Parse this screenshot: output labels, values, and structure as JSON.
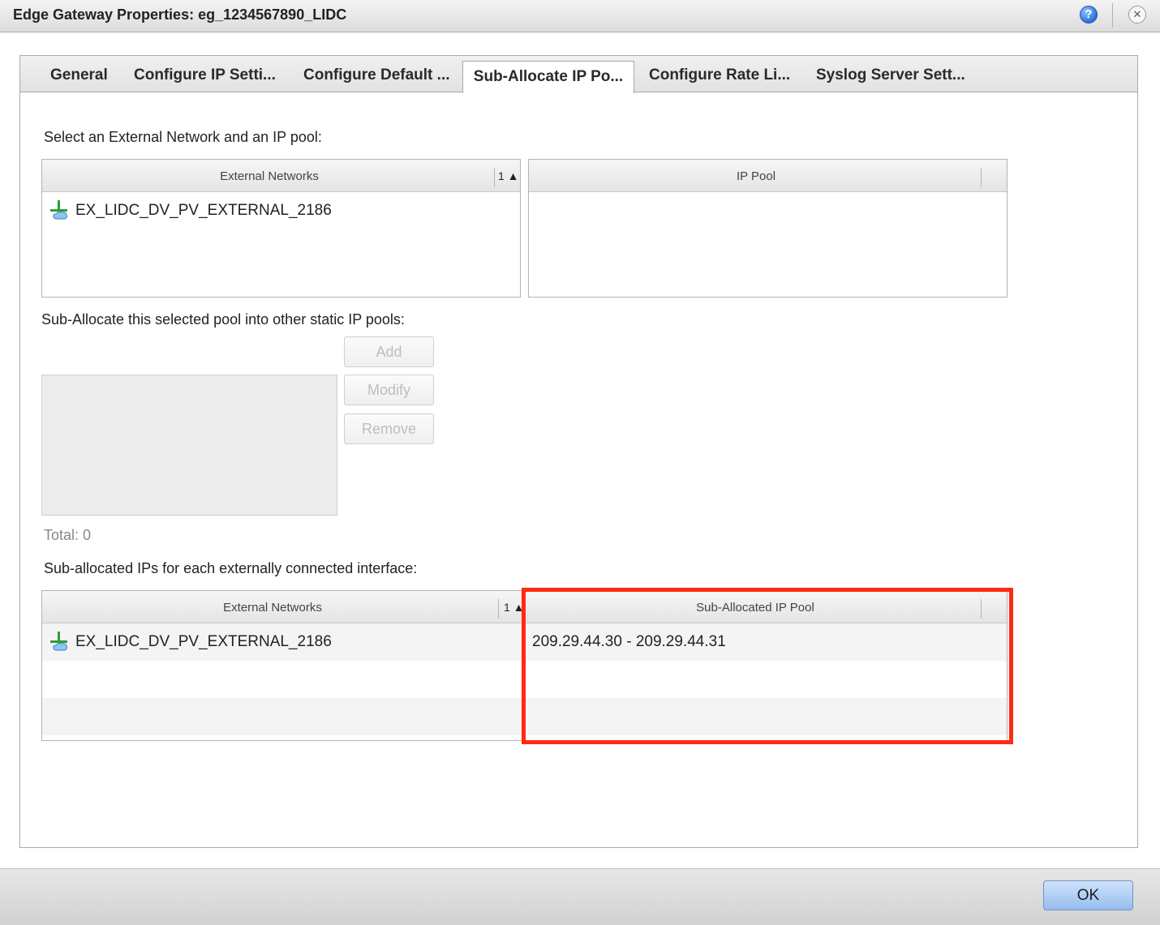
{
  "window": {
    "title": "Edge Gateway Properties: eg_1234567890_LIDC",
    "help_glyph": "?",
    "close_glyph": "✕"
  },
  "tabs": [
    {
      "label": "General",
      "active": false
    },
    {
      "label": "Configure IP Setti...",
      "active": false
    },
    {
      "label": "Configure Default ...",
      "active": false
    },
    {
      "label": "Sub-Allocate IP Po...",
      "active": true
    },
    {
      "label": "Configure Rate Li...",
      "active": false
    },
    {
      "label": "Syslog Server Sett...",
      "active": false
    }
  ],
  "select_section": {
    "label": "Select an External Network and an IP pool:",
    "networks_grid": {
      "header": "External Networks",
      "sort_indicator": "1 ▲",
      "rows": [
        {
          "name": "EX_LIDC_DV_PV_EXTERNAL_2186",
          "icon": "network-icon"
        }
      ]
    },
    "pool_grid": {
      "header": "IP Pool",
      "rows": []
    }
  },
  "suballocate_section": {
    "label": "Sub-Allocate this selected pool into other static IP pools:",
    "buttons": {
      "add": "Add",
      "modify": "Modify",
      "remove": "Remove"
    },
    "total_label": "Total: 0"
  },
  "suballocated_section": {
    "label": "Sub-allocated IPs for each externally connected interface:",
    "grid": {
      "col1_header": "External Networks",
      "sort_indicator": "1 ▲",
      "col2_header": "Sub-Allocated IP Pool",
      "rows": [
        {
          "network": "EX_LIDC_DV_PV_EXTERNAL_2186",
          "pool": "209.29.44.30 - 209.29.44.31",
          "icon": "network-icon"
        }
      ]
    }
  },
  "footer": {
    "ok_label": "OK"
  },
  "colors": {
    "highlight": "#ff2a12",
    "ok_button": "#96bdee",
    "help_icon": "#2b73d9"
  }
}
